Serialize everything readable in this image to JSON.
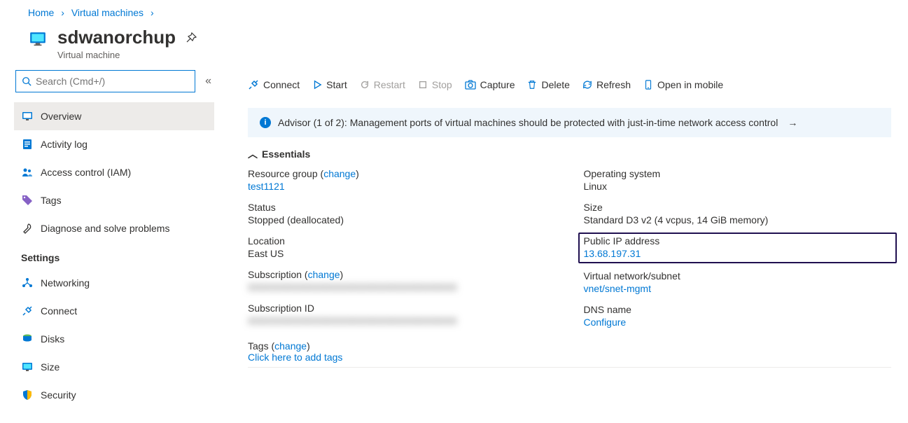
{
  "breadcrumb": {
    "home": "Home",
    "vms": "Virtual machines"
  },
  "title": {
    "name": "sdwanorchup",
    "subtitle": "Virtual machine"
  },
  "search": {
    "placeholder": "Search (Cmd+/)"
  },
  "sidebar": {
    "overview": "Overview",
    "activitylog": "Activity log",
    "iam": "Access control (IAM)",
    "tags": "Tags",
    "diagnose": "Diagnose and solve problems",
    "settings_header": "Settings",
    "networking": "Networking",
    "connect": "Connect",
    "disks": "Disks",
    "size": "Size",
    "security": "Security"
  },
  "toolbar": {
    "connect": "Connect",
    "start": "Start",
    "restart": "Restart",
    "stop": "Stop",
    "capture": "Capture",
    "delete": "Delete",
    "refresh": "Refresh",
    "openmobile": "Open in mobile"
  },
  "advisor": {
    "text": "Advisor (1 of 2): Management ports of virtual machines should be protected with just-in-time network access control"
  },
  "essentials": {
    "header": "Essentials",
    "left": {
      "rg_label": "Resource group",
      "rg_change": "change",
      "rg_value": "test1121",
      "status_label": "Status",
      "status_value": "Stopped (deallocated)",
      "location_label": "Location",
      "location_value": "East US",
      "sub_label": "Subscription",
      "sub_change": "change",
      "sub_value": "XXXXXXXXXXXXXXXXXXXXXXXXXXXXXXXX",
      "subid_label": "Subscription ID",
      "subid_value": "XXXXXXXXXXXXXXXXXXXXXXXXXXXXXXXX"
    },
    "right": {
      "os_label": "Operating system",
      "os_value": "Linux",
      "size_label": "Size",
      "size_value": "Standard D3 v2 (4 vcpus, 14 GiB memory)",
      "pip_label": "Public IP address",
      "pip_value": "13.68.197.31",
      "vnet_label": "Virtual network/subnet",
      "vnet_value": "vnet/snet-mgmt",
      "dns_label": "DNS name",
      "dns_value": "Configure"
    },
    "tags_label": "Tags",
    "tags_change": "change",
    "tags_value": "Click here to add tags"
  }
}
